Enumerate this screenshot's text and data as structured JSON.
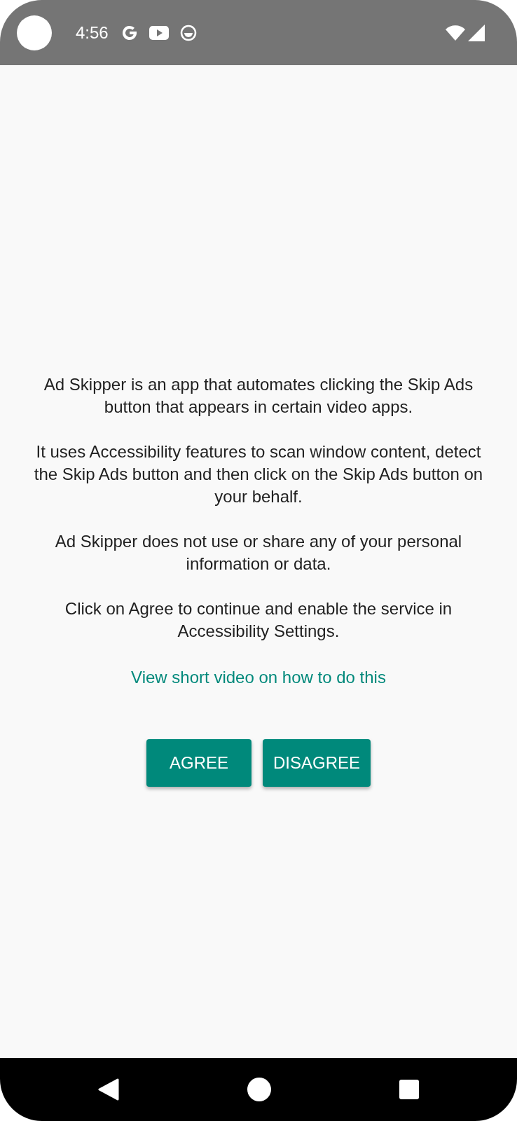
{
  "status_bar": {
    "time": "4:56"
  },
  "paragraphs": [
    "Ad Skipper is an app that automates clicking the Skip Ads button that appears in certain video apps.",
    "It uses Accessibility features to scan window content, detect the Skip Ads button and then click on the Skip Ads button on your behalf.",
    "Ad Skipper does not use or share any of your personal information or data.",
    "Click on Agree to continue and enable the service in Accessibility Settings."
  ],
  "link": "View short video on how to do this",
  "buttons": [
    "AGREE",
    "DISAGREE"
  ]
}
